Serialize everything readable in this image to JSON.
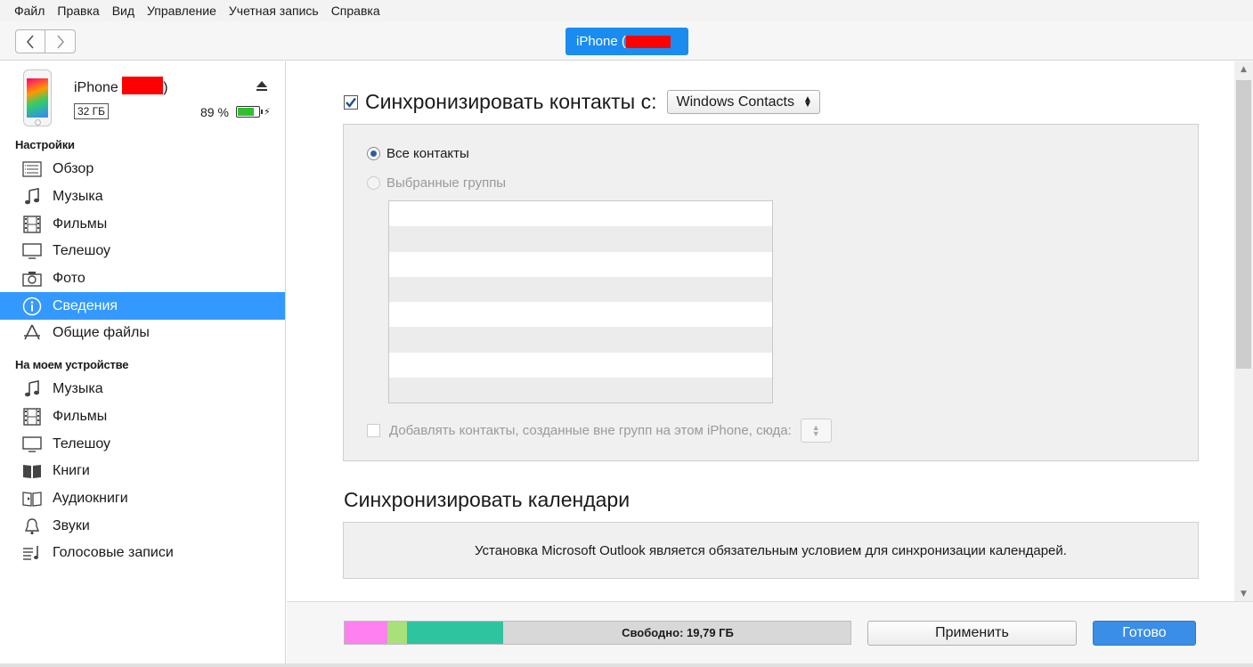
{
  "menu": [
    "Файл",
    "Правка",
    "Вид",
    "Управление",
    "Учетная запись",
    "Справка"
  ],
  "toolbar": {
    "device_tab_label": "iPhone (",
    "back_icon": "chevron-left-icon",
    "forward_icon": "chevron-right-icon"
  },
  "device": {
    "name": "iPhone",
    "name_suffix": ")",
    "capacity": "32 ГБ",
    "battery": "89 %",
    "battery_level": 0.89
  },
  "sidebar": {
    "settings_title": "Настройки",
    "settings_items": [
      {
        "label": "Обзор",
        "icon": "summary-icon"
      },
      {
        "label": "Музыка",
        "icon": "music-note-icon"
      },
      {
        "label": "Фильмы",
        "icon": "film-icon"
      },
      {
        "label": "Телешоу",
        "icon": "tv-icon"
      },
      {
        "label": "Фото",
        "icon": "camera-icon"
      },
      {
        "label": "Сведения",
        "icon": "info-icon"
      },
      {
        "label": "Общие файлы",
        "icon": "apps-icon"
      }
    ],
    "device_title": "На моем устройстве",
    "device_items": [
      {
        "label": "Музыка",
        "icon": "music-note-icon"
      },
      {
        "label": "Фильмы",
        "icon": "film-icon"
      },
      {
        "label": "Телешоу",
        "icon": "tv-icon"
      },
      {
        "label": "Книги",
        "icon": "book-icon"
      },
      {
        "label": "Аудиокниги",
        "icon": "audiobook-icon"
      },
      {
        "label": "Звуки",
        "icon": "bell-icon"
      },
      {
        "label": "Голосовые записи",
        "icon": "voice-memo-icon"
      }
    ]
  },
  "contacts": {
    "sync_label": "Синхронизировать контакты с:",
    "source": "Windows Contacts",
    "all_contacts": "Все контакты",
    "selected_groups": "Выбранные группы",
    "add_contacts_label": "Добавлять контакты, созданные вне групп на этом iPhone, сюда:"
  },
  "calendars": {
    "title": "Синхронизировать календари",
    "message": "Установка Microsoft Outlook является обязательным условием для синхронизации календарей."
  },
  "bottom": {
    "free_label": "Свободно: 19,79 ГБ",
    "apply": "Применить",
    "done": "Готово"
  },
  "colors": {
    "accent": "#3399ff",
    "done_button": "#3a8ee6",
    "storage_pink": "#ff80f0",
    "storage_green": "#a8e07a",
    "storage_teal": "#2ec4a0",
    "storage_free": "#d8d8d8"
  }
}
